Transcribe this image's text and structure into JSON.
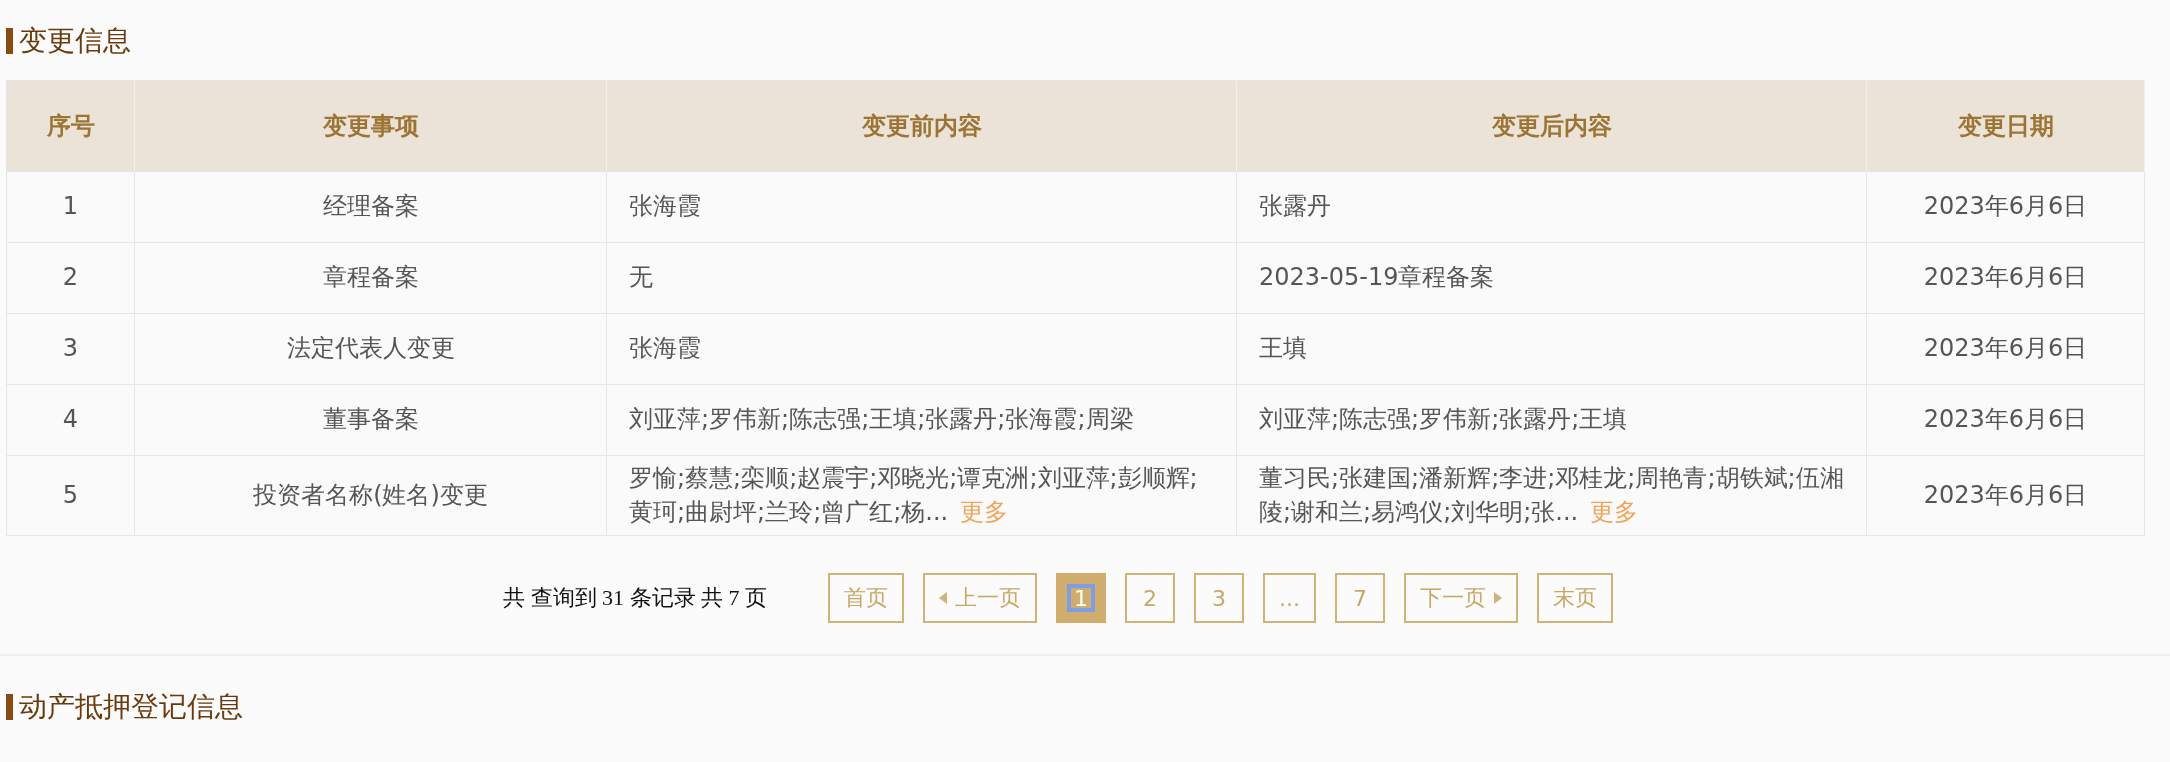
{
  "sections": [
    {
      "title": "变更信息"
    },
    {
      "title": "动产抵押登记信息"
    }
  ],
  "table": {
    "columns": [
      "序号",
      "变更事项",
      "变更前内容",
      "变更后内容",
      "变更日期"
    ],
    "rows": [
      {
        "index": "1",
        "item": "经理备案",
        "before": {
          "text": "张海霞"
        },
        "after": {
          "text": "张露丹"
        },
        "date": "2023年6月6日"
      },
      {
        "index": "2",
        "item": "章程备案",
        "before": {
          "text": "无"
        },
        "after": {
          "text": "2023-05-19章程备案"
        },
        "date": "2023年6月6日"
      },
      {
        "index": "3",
        "item": "法定代表人变更",
        "before": {
          "text": "张海霞"
        },
        "after": {
          "text": "王填"
        },
        "date": "2023年6月6日"
      },
      {
        "index": "4",
        "item": "董事备案",
        "before": {
          "text": "刘亚萍;罗伟新;陈志强;王填;张露丹;张海霞;周梁"
        },
        "after": {
          "text": "刘亚萍;陈志强;罗伟新;张露丹;王填"
        },
        "date": "2023年6月6日"
      },
      {
        "index": "5",
        "item": "投资者名称(姓名)变更",
        "before": {
          "text": "罗愉;蔡慧;栾顺;赵震宇;邓晓光;谭克洲;刘亚萍;彭顺辉;黄珂;曲尉坪;兰玲;曾广红;杨...",
          "more": "更多"
        },
        "after": {
          "text": "董习民;张建国;潘新辉;李进;邓桂龙;周艳青;胡铁斌;伍湘陵;谢和兰;易鸿仪;刘华明;张...",
          "more": "更多"
        },
        "date": "2023年6月6日"
      }
    ]
  },
  "pagination": {
    "summary": "共 查询到 31 条记录 共 7 页",
    "first": "首页",
    "prev": "上一页",
    "pages": [
      {
        "label": "1",
        "selected": true
      },
      {
        "label": "2",
        "selected": false
      },
      {
        "label": "3",
        "selected": false
      },
      {
        "label": "...",
        "selected": false
      },
      {
        "label": "7",
        "selected": false
      }
    ],
    "next": "下一页",
    "last": "末页"
  }
}
